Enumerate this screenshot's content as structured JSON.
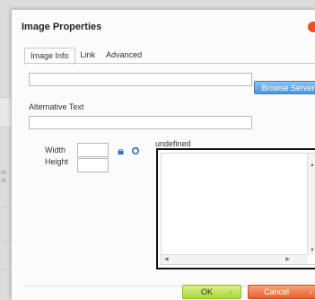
{
  "background": {
    "side_text_line1": "nı",
    "side_text_line2": "st"
  },
  "dialog": {
    "title": "Image Properties",
    "tabs": [
      {
        "label": "Image Info",
        "active": true
      },
      {
        "label": "Link",
        "active": false
      },
      {
        "label": "Advanced",
        "active": false
      }
    ],
    "url_value": "",
    "browse_label": "Browse Server",
    "alt_label": "Alternative Text",
    "alt_value": "",
    "width_label": "Width",
    "height_label": "Height",
    "width_value": "",
    "height_value": "",
    "preview_label": "undefined",
    "ok_label": "OK",
    "cancel_label": "Cancel",
    "button_arrow": "›"
  },
  "colors": {
    "close": "#e8521f",
    "browse": "#4f95d6",
    "ok": "#a8d63a",
    "cancel": "#e8602c"
  }
}
